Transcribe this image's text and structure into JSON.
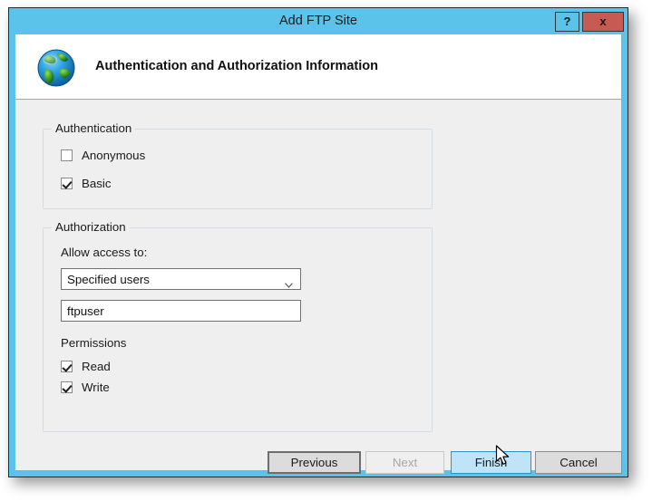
{
  "window": {
    "title": "Add FTP Site",
    "help_label": "?",
    "close_label": "x",
    "frame_color": "#5bc2ea",
    "close_color": "#c75b53"
  },
  "header": {
    "icon": "globe-icon",
    "title": "Authentication and Authorization Information"
  },
  "authentication": {
    "legend": "Authentication",
    "options": [
      {
        "label": "Anonymous",
        "checked": false
      },
      {
        "label": "Basic",
        "checked": true
      }
    ]
  },
  "authorization": {
    "legend": "Authorization",
    "allow_access_label": "Allow access to:",
    "access_select": {
      "value": "Specified users",
      "arrow_icon": "chevron-down-icon"
    },
    "users_field": {
      "value": "ftpuser",
      "placeholder": ""
    },
    "permissions": {
      "legend": "Permissions",
      "options": [
        {
          "label": "Read",
          "checked": true
        },
        {
          "label": "Write",
          "checked": true
        }
      ]
    }
  },
  "footer": {
    "previous_label": "Previous",
    "next_label": "Next",
    "finish_label": "Finish",
    "cancel_label": "Cancel"
  },
  "cursor": {
    "icon": "arrow-pointer-icon"
  }
}
